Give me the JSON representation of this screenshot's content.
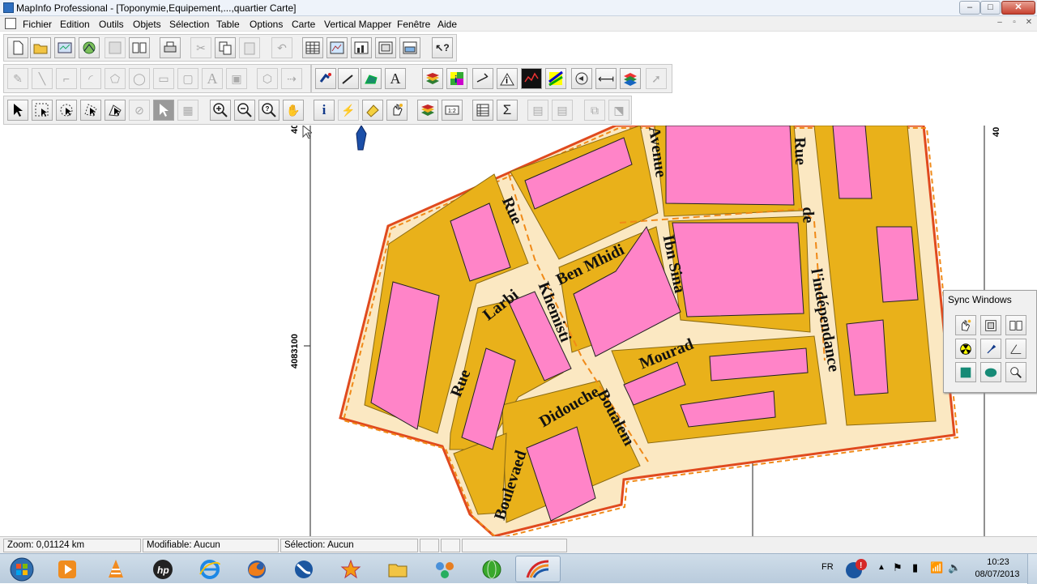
{
  "window": {
    "title": "MapInfo Professional - [Toponymie,Equipement,...,quartier Carte]",
    "controls": {
      "minimize": "‒",
      "maximize": "□",
      "close": "✕"
    }
  },
  "menu": {
    "items": [
      "Fichier",
      "Edition",
      "Outils",
      "Objets",
      "Sélection",
      "Table",
      "Options",
      "Carte",
      "Vertical Mapper",
      "Fenêtre",
      "Aide"
    ],
    "doc_controls": {
      "minimize": "‒",
      "restore": "▫",
      "close": "✕"
    }
  },
  "toolbars": {
    "standard": [
      "new-icon",
      "open-icon",
      "open-workspace-icon",
      "open-dbms-icon",
      "save-icon",
      "save-copy-icon",
      "print-icon",
      "cut-icon",
      "copy-icon",
      "paste-icon",
      "undo-icon",
      "new-browser-icon",
      "new-mapper-icon",
      "new-grapher-icon",
      "new-layout-icon",
      "new-redistrict-icon",
      "help-icon"
    ],
    "drawing": [
      "symbol-icon",
      "line-icon",
      "polyline-icon",
      "arc-icon",
      "polygon-icon",
      "ellipse-icon",
      "rectangle-icon",
      "rounded-rect-icon",
      "text-icon",
      "frame-icon",
      "reshape-icon",
      "add-node-icon"
    ],
    "tools": [
      "hotlink-icon",
      "line-style-icon",
      "region-style-icon",
      "text-style-icon",
      "layer-control-icon",
      "thematic-icon",
      "distance-icon",
      "info-icon",
      "legend-icon",
      "grid-icon",
      "rotate-icon",
      "statistics-icon",
      "sync-icon",
      "select-arrow-icon"
    ],
    "main": [
      "select-icon",
      "marquee-select-icon",
      "radius-select-icon",
      "polygon-select-icon",
      "boundary-select-icon",
      "unselect-icon",
      "graph-select-icon",
      "label-icon",
      "zoom-in-icon",
      "zoom-out-icon",
      "change-view-icon",
      "grabber-icon",
      "info-tool-icon",
      "hotlink-tool-icon",
      "label-tool-icon",
      "drag-window-icon",
      "layer-control-icon",
      "ruler-icon",
      "browser-icon",
      "statistics-sum-icon",
      "legend-a-icon",
      "legend-b-icon",
      "scale-bar-icon",
      "clip-region-icon"
    ]
  },
  "map": {
    "axis_label_top": "40",
    "axis_label_mid": "4083100",
    "axis_label_right": "40",
    "street_labels": [
      "Rue",
      "Avenue",
      "Rue",
      "de",
      "Ben Mhidi",
      "Ibn Sina",
      "Larbi",
      "Khemisti",
      "l'indépendance",
      "Mourad",
      "Rue",
      "Didouche",
      "Boualem",
      "Boulevaed"
    ],
    "colors": {
      "block_fill": "#e9b11a",
      "road_fill": "#fbe8c2",
      "building_fill": "#ff84c8",
      "outline": "#e04a1e",
      "road_dash": "#f08a18"
    }
  },
  "sync_window": {
    "title": "Sync Windows",
    "buttons": [
      "sync-hand-icon",
      "sync-layout-icon",
      "sync-book-icon",
      "sync-radiation-icon",
      "sync-pin-icon",
      "sync-line-icon",
      "sync-square-icon",
      "sync-ellipse-icon",
      "sync-zoom-icon"
    ]
  },
  "status": {
    "zoom": "Zoom: 0,01124 km",
    "modifiable": "Modifiable: Aucun",
    "selection": "Sélection: Aucun"
  },
  "taskbar": {
    "apps": [
      "start-orb-icon",
      "media-player-icon",
      "vlc-icon",
      "hp-icon",
      "internet-explorer-icon",
      "firefox-icon",
      "google-earth-icon",
      "game-icon",
      "file-explorer-icon",
      "network-icon",
      "globe-app-icon",
      "mapinfo-icon"
    ],
    "lang": "FR",
    "time": "10:23",
    "date": "08/07/2013"
  }
}
